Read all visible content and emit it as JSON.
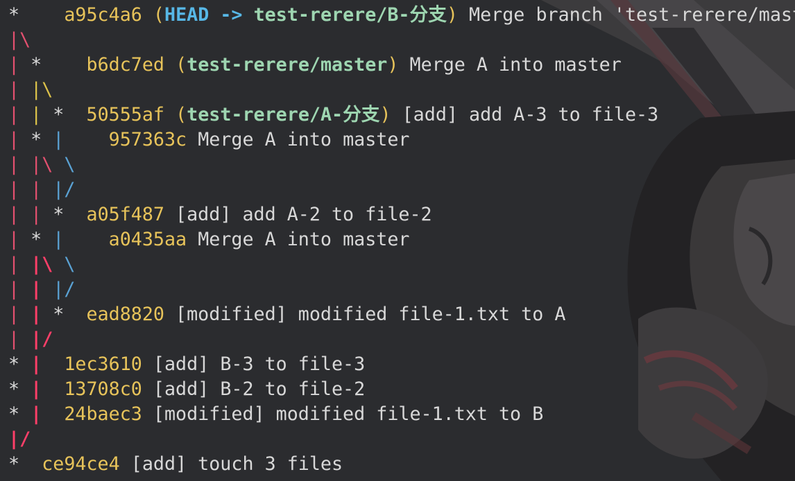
{
  "colors": {
    "background": "#2a2b2e",
    "graph_pink": "#e3506f",
    "graph_yellow": "#dcc24a",
    "graph_blue": "#5aa2d4",
    "sha": "#e7c35a",
    "head": "#57b7e6",
    "branch": "#9ed6b1",
    "text": "#d8d8d8"
  },
  "log": [
    {
      "graph": [
        [
          "star",
          "*"
        ],
        [
          "none",
          "   "
        ]
      ],
      "sha": "a95c4a6",
      "refs": {
        "head": "HEAD",
        "arrow": " -> ",
        "branch": "test-rerere/B-分支"
      },
      "message": " Merge branch 'test-rerere/mast"
    },
    {
      "graph": [
        [
          "pink",
          "|\\"
        ]
      ],
      "sha": "",
      "message": ""
    },
    {
      "graph": [
        [
          "pink",
          "| "
        ],
        [
          "star",
          "*"
        ],
        [
          "none",
          "   "
        ]
      ],
      "sha": "b6dc7ed",
      "refs": {
        "branch": "test-rerere/master"
      },
      "message": " Merge A into master"
    },
    {
      "graph": [
        [
          "pink",
          "| "
        ],
        [
          "yellow",
          "|\\"
        ]
      ],
      "sha": "",
      "message": ""
    },
    {
      "graph": [
        [
          "pink",
          "| "
        ],
        [
          "yellow",
          "| "
        ],
        [
          "star",
          "* "
        ]
      ],
      "sha": "50555af",
      "refs": {
        "branch": "test-rerere/A-分支"
      },
      "message": " [add] add A-3 to file-3"
    },
    {
      "graph": [
        [
          "pink",
          "| "
        ],
        [
          "star",
          "* "
        ],
        [
          "blue",
          "|   "
        ]
      ],
      "sha": "957363c",
      "message": " Merge A into master"
    },
    {
      "graph": [
        [
          "pink",
          "| "
        ],
        [
          "pink",
          "|\\ "
        ],
        [
          "blue",
          "\\"
        ]
      ],
      "sha": "",
      "message": ""
    },
    {
      "graph": [
        [
          "pink",
          "| "
        ],
        [
          "pink",
          "| "
        ],
        [
          "blue",
          "|/"
        ]
      ],
      "sha": "",
      "message": ""
    },
    {
      "graph": [
        [
          "pink",
          "| "
        ],
        [
          "pink",
          "| "
        ],
        [
          "star",
          "* "
        ]
      ],
      "sha": "a05f487",
      "message": " [add] add A-2 to file-2"
    },
    {
      "graph": [
        [
          "pink",
          "| "
        ],
        [
          "star",
          "* "
        ],
        [
          "blue",
          "|   "
        ]
      ],
      "sha": "a0435aa",
      "message": " Merge A into master"
    },
    {
      "graph": [
        [
          "pink",
          "| "
        ],
        [
          "pinkb",
          "|\\ "
        ],
        [
          "blue",
          "\\"
        ]
      ],
      "sha": "",
      "message": ""
    },
    {
      "graph": [
        [
          "pink",
          "| "
        ],
        [
          "pinkb",
          "| "
        ],
        [
          "blue",
          "|/"
        ]
      ],
      "sha": "",
      "message": ""
    },
    {
      "graph": [
        [
          "pink",
          "| "
        ],
        [
          "pinkb",
          "| "
        ],
        [
          "star",
          "* "
        ]
      ],
      "sha": "ead8820",
      "message": " [modified] modified file-1.txt to A"
    },
    {
      "graph": [
        [
          "pink",
          "| "
        ],
        [
          "pinkb",
          "|/"
        ]
      ],
      "sha": "",
      "message": ""
    },
    {
      "graph": [
        [
          "star",
          "* "
        ],
        [
          "pinkb",
          "| "
        ]
      ],
      "sha": "1ec3610",
      "message": " [add] B-3 to file-3"
    },
    {
      "graph": [
        [
          "star",
          "* "
        ],
        [
          "pinkb",
          "| "
        ]
      ],
      "sha": "13708c0",
      "message": " [add] B-2 to file-2"
    },
    {
      "graph": [
        [
          "star",
          "* "
        ],
        [
          "pinkb",
          "| "
        ]
      ],
      "sha": "24baec3",
      "message": " [modified] modified file-1.txt to B"
    },
    {
      "graph": [
        [
          "pinkb",
          "|/"
        ]
      ],
      "sha": "",
      "message": ""
    },
    {
      "graph": [
        [
          "star",
          "* "
        ]
      ],
      "sha": "ce94ce4",
      "message": " [add] touch 3 files"
    }
  ]
}
